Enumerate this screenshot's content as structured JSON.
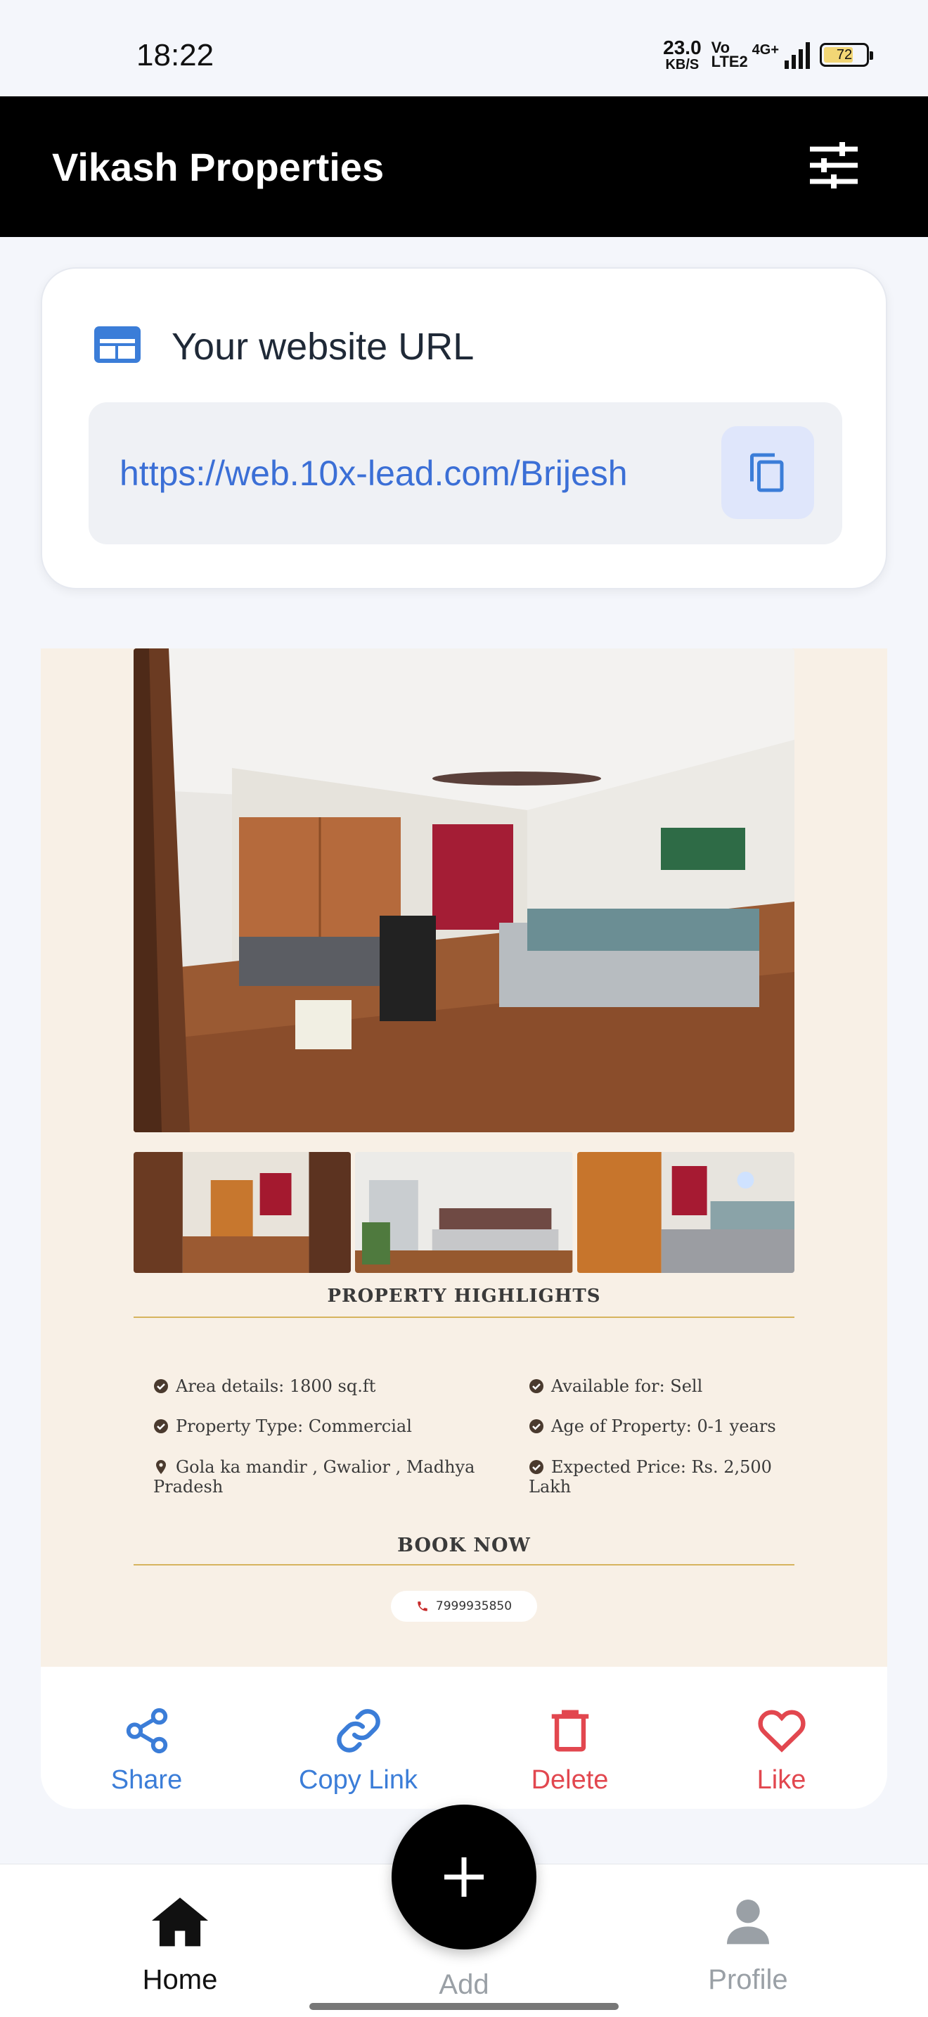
{
  "status_bar": {
    "time": "18:22",
    "net_speed_value": "23.0",
    "net_speed_unit": "KB/S",
    "volte": "Vo LTE2",
    "network": "4G+",
    "battery": "72"
  },
  "app_bar": {
    "title": "Vikash Properties",
    "filter_icon": "sliders-icon"
  },
  "url_card": {
    "heading": "Your website URL",
    "url": "https://web.10x-lead.com/Brijesh",
    "copy_icon": "copy-icon"
  },
  "property": {
    "highlights_heading": "PROPERTY HIGHLIGHTS",
    "highlights": [
      {
        "text": "Area details: 1800 sq.ft",
        "icon": "check-circle-icon"
      },
      {
        "text": "Available for: Sell",
        "icon": "check-circle-icon"
      },
      {
        "text": "Property Type: Commercial",
        "icon": "check-circle-icon"
      },
      {
        "text": "Age of Property: 0-1 years",
        "icon": "check-circle-icon"
      },
      {
        "text": "Gola ka mandir , Gwalior , Madhya Pradesh",
        "icon": "map-pin-icon"
      },
      {
        "text": "Expected Price: Rs. 2,500 Lakh",
        "icon": "check-circle-icon"
      }
    ],
    "book_heading": "BOOK NOW",
    "phone": "7999935850"
  },
  "actions": {
    "share": "Share",
    "copy_link": "Copy Link",
    "delete": "Delete",
    "like": "Like"
  },
  "bottom_nav": {
    "home": "Home",
    "add": "Add",
    "profile": "Profile"
  },
  "colors": {
    "accent_blue": "#3b7dd8",
    "danger_red": "#e2474f",
    "flyer_bg": "#f8f0e6",
    "gold": "#d6b45e"
  }
}
